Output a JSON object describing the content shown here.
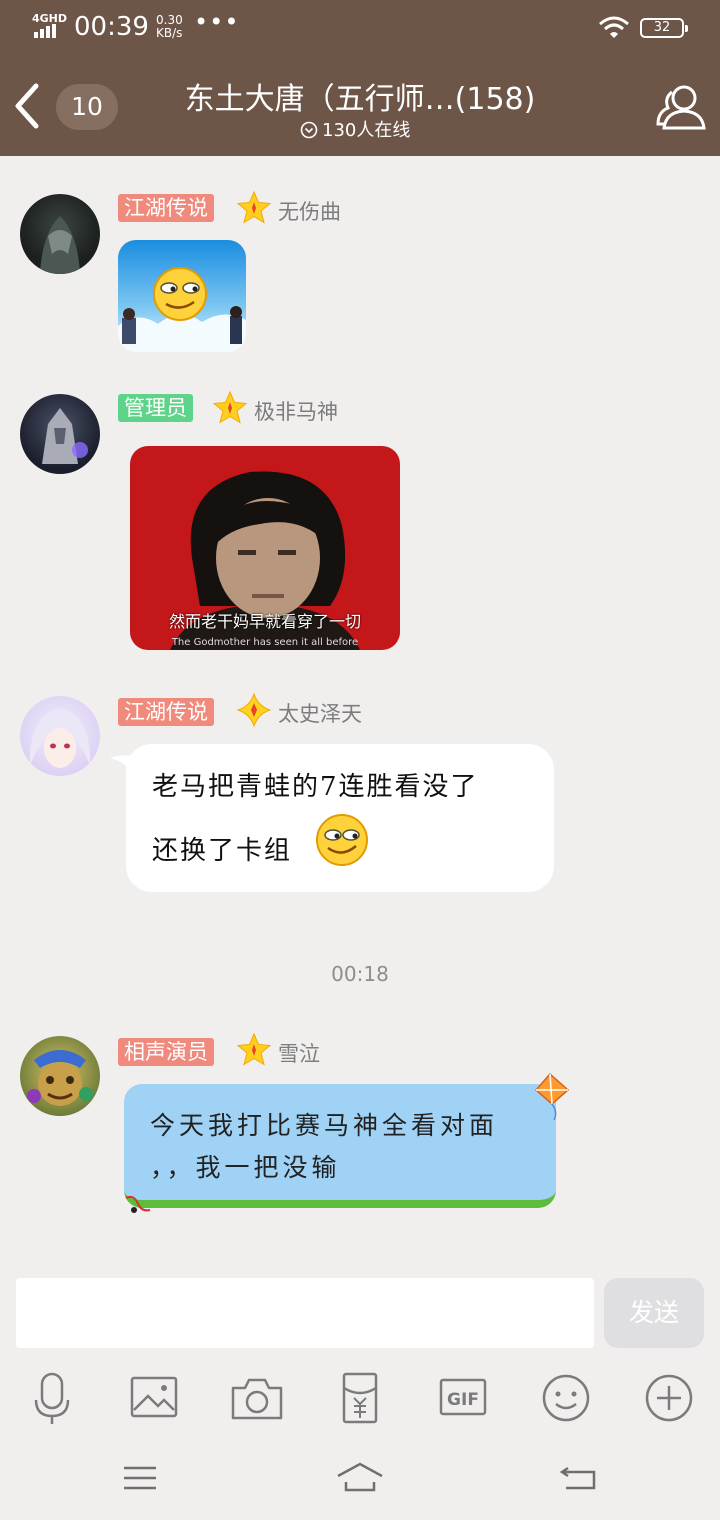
{
  "status_bar": {
    "network": "4GHD",
    "time": "00:39",
    "speed_value": "0.30",
    "speed_unit": "KB/s",
    "more": "•••",
    "battery": "32"
  },
  "header": {
    "back_icon": "chevron-left-icon",
    "unread_count": "10",
    "title": "东土大唐（五行师…(158)",
    "online": "130人在线",
    "members_icon": "group-members-icon",
    "color": "#6d5548"
  },
  "messages": [
    {
      "badge": "江湖传说",
      "badge_color": "#f08a7c",
      "name": "无伤曲",
      "type": "sticker"
    },
    {
      "badge": "管理员",
      "badge_color": "#5ed38a",
      "name": "极非马神",
      "type": "image",
      "caption": "然而老干妈早就看穿了一切",
      "caption_en": "The Godmother has seen it all before"
    },
    {
      "badge": "江湖传说",
      "badge_color": "#f08a7c",
      "name": "太史泽天",
      "type": "text",
      "lines": [
        "老马把青蛙的7连胜看没了",
        "还换了卡组"
      ]
    },
    {
      "badge": "相声演员",
      "badge_color": "#f08a7c",
      "name": "雪泣",
      "type": "text",
      "lines": [
        "今天我打比赛马神全看对面",
        "，，我一把没输"
      ]
    }
  ],
  "timestamp": "00:18",
  "composer": {
    "send_label": "发送",
    "tools": [
      "microphone-icon",
      "image-icon",
      "camera-icon",
      "red-packet-icon",
      "gif-icon",
      "emoji-icon",
      "plus-icon"
    ]
  },
  "nav_bar": [
    "menu-icon",
    "home-icon",
    "back-icon"
  ]
}
